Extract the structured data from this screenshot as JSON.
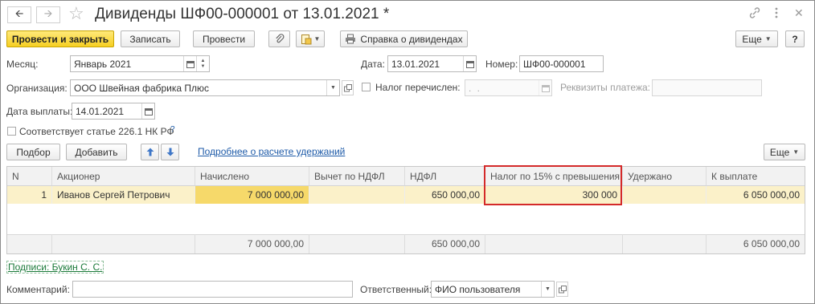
{
  "window": {
    "title": "Дивиденды ШФ00-000001 от 13.01.2021 *"
  },
  "toolbar": {
    "post_and_close": "Провести и закрыть",
    "save": "Записать",
    "post": "Провести",
    "dividend_report": "Справка о дивидендах",
    "more": "Еще",
    "help": "?"
  },
  "form": {
    "month_label": "Месяц:",
    "month_value": "Январь 2021",
    "date_label": "Дата:",
    "date_value": "13.01.2021",
    "number_label": "Номер:",
    "number_value": "ШФ00-000001",
    "org_label": "Организация:",
    "org_value": "ООО Швейная фабрика Плюс",
    "tax_transferred_label": "Налог перечислен:",
    "tax_transferred_value": " .  .",
    "payment_details_label": "Реквизиты платежа:",
    "pay_date_label": "Дата выплаты:",
    "pay_date_value": "14.01.2021",
    "art_label": "Соответствует статье 226.1 НК РФ",
    "art_help": "?"
  },
  "table_toolbar": {
    "select": "Подбор",
    "add": "Добавить",
    "details_link": "Подробнее о расчете удержаний",
    "more": "Еще"
  },
  "table": {
    "columns": [
      "N",
      "Акционер",
      "Начислено",
      "Вычет по НДФЛ",
      "НДФЛ",
      "Налог по 15% с превышения",
      "Удержано",
      "К выплате"
    ],
    "rows": [
      {
        "n": "1",
        "shareholder": "Иванов Сергей Петрович",
        "accrued": "7 000 000,00",
        "deduction": "",
        "ndfl": "650 000,00",
        "tax15": "300 000",
        "withheld": "",
        "payout": "6 050 000,00"
      }
    ],
    "totals": {
      "accrued": "7 000 000,00",
      "ndfl": "650 000,00",
      "payout": "6 050 000,00"
    }
  },
  "footer": {
    "signatures_link": "Подписи: Букин С. С.",
    "comment_label": "Комментарий:",
    "comment_value": "",
    "responsible_label": "Ответственный:",
    "responsible_value": "ФИО пользователя"
  },
  "colors": {
    "primary_button": "#f6cf22",
    "selected_row": "#fbf1c9",
    "highlight_border": "#d42a2a",
    "link": "#1d5aa8"
  }
}
